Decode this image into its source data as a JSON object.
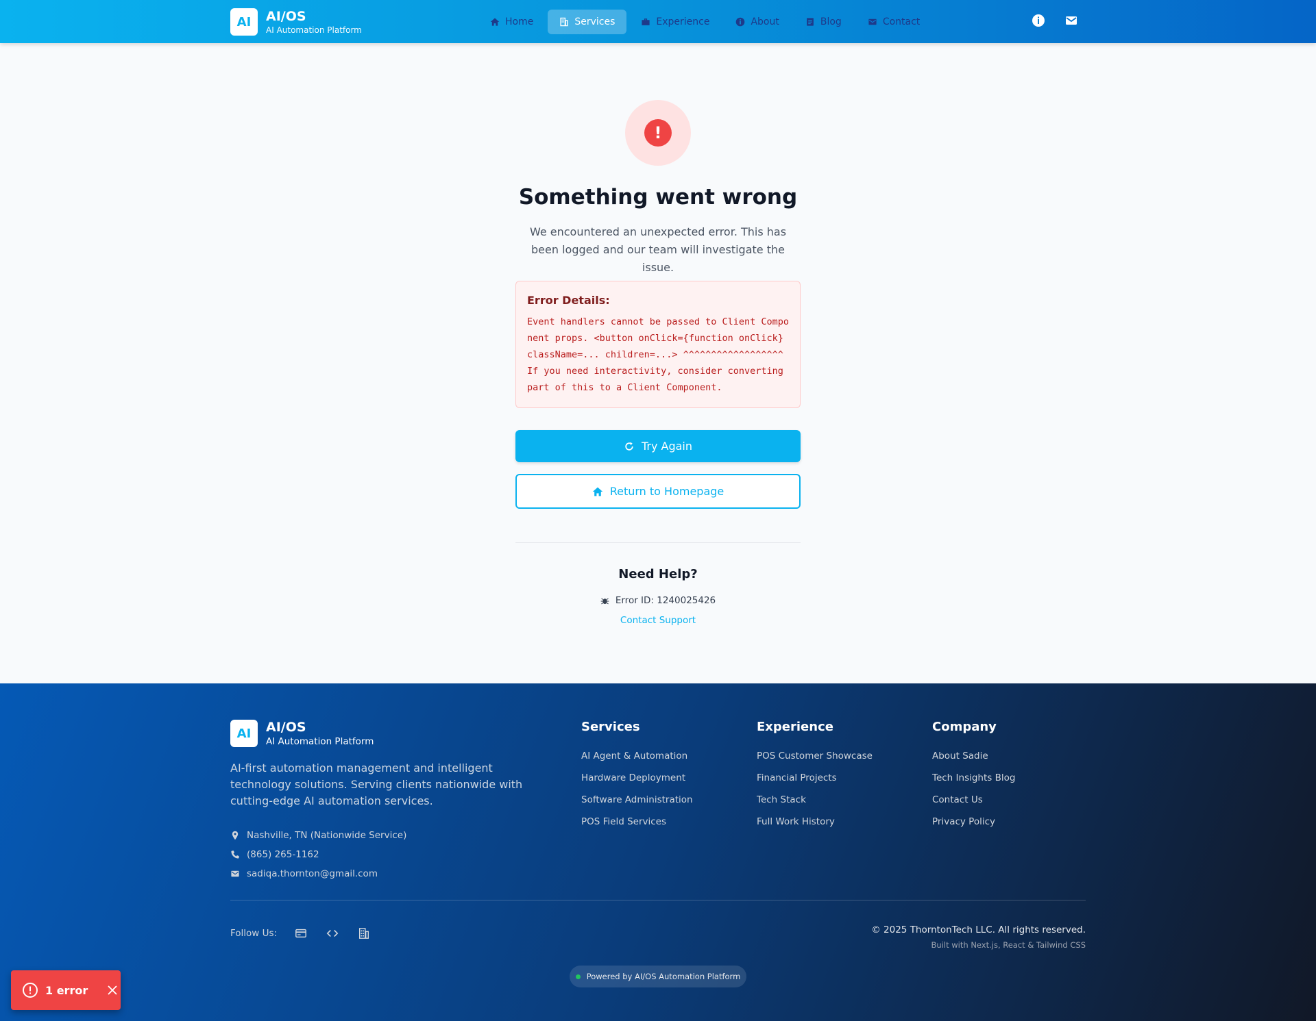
{
  "nav": {
    "logo": "AI",
    "title": "AI/OS",
    "subtitle": "AI Automation Platform",
    "links": [
      {
        "label": "Home",
        "icon": "home-icon"
      },
      {
        "label": "Services",
        "icon": "building-icon",
        "active": true
      },
      {
        "label": "Experience",
        "icon": "briefcase-icon"
      },
      {
        "label": "About",
        "icon": "info-icon"
      },
      {
        "label": "Blog",
        "icon": "document-icon"
      },
      {
        "label": "Contact",
        "icon": "mail-icon"
      }
    ],
    "right_icons": [
      "info-icon",
      "mail-icon"
    ]
  },
  "error": {
    "heading": "Something went wrong",
    "subtext": "We encountered an unexpected error. This has been logged and our team will investigate the issue.",
    "details_title": "Error Details:",
    "details_body": "Event handlers cannot be passed to Client Component props. <button onClick={function onClick} className=... children=...> ^^^^^^^^^^^^^^^^^^ If you need interactivity, consider converting part of this to a Client Component.",
    "try_again": "Try Again",
    "return_home": "Return to Homepage",
    "help_title": "Need Help?",
    "error_id": "Error ID: 1240025426",
    "contact_support": "Contact Support"
  },
  "footer": {
    "logo": "AI",
    "title": "AI/OS",
    "subtitle": "AI Automation Platform",
    "description": "AI-first automation management and intelligent technology solutions. Serving clients nationwide with cutting-edge AI automation services.",
    "contacts": [
      {
        "icon": "location-icon",
        "text": "Nashville, TN (Nationwide Service)"
      },
      {
        "icon": "phone-icon",
        "text": "(865) 265-1162"
      },
      {
        "icon": "mail-icon",
        "text": "sadiqa.thornton@gmail.com"
      }
    ],
    "columns": [
      {
        "title": "Services",
        "items": [
          "AI Agent & Automation",
          "Hardware Deployment",
          "Software Administration",
          "POS Field Services"
        ]
      },
      {
        "title": "Experience",
        "items": [
          "POS Customer Showcase",
          "Financial Projects",
          "Tech Stack",
          "Full Work History"
        ]
      },
      {
        "title": "Company",
        "items": [
          "About Sadie",
          "Tech Insights Blog",
          "Contact Us",
          "Privacy Policy"
        ]
      }
    ],
    "follow_label": "Follow Us:",
    "social_icons": [
      "card-icon",
      "code-icon",
      "building-icon"
    ],
    "copyright": "© 2025 ThorntonTech LLC. All rights reserved.",
    "built_with": "Built with Next.js, React & Tailwind CSS",
    "powered": "Powered by AI/OS Automation Platform"
  },
  "toast": {
    "label": "1 error"
  },
  "colors": {
    "accent": "#0ab2ef",
    "error": "#ef4444",
    "footer_start": "#0559b5",
    "footer_end": "#111827"
  }
}
